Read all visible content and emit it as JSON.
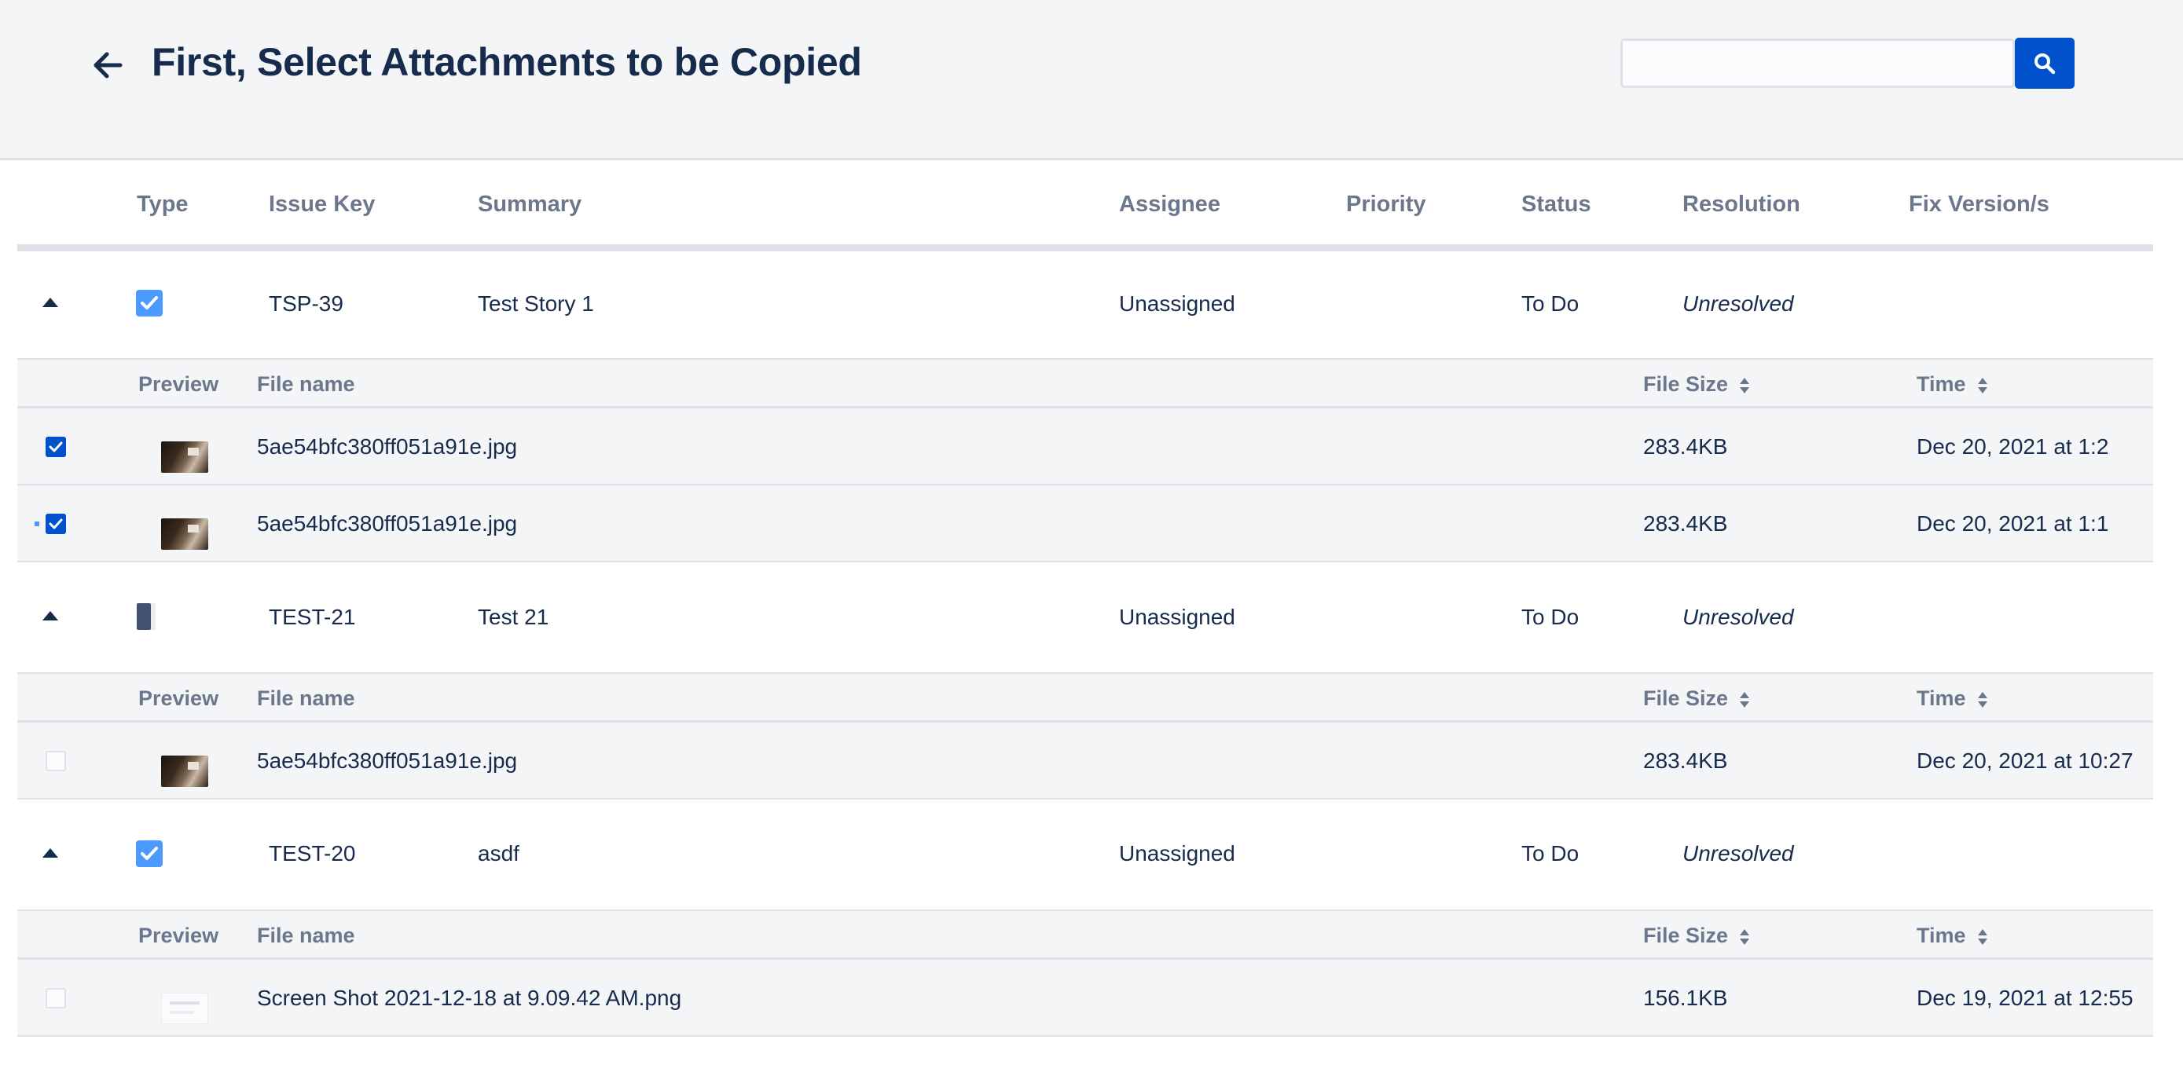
{
  "header": {
    "title": "First, Select Attachments to be Copied",
    "search_placeholder": "",
    "search_value": ""
  },
  "columns": {
    "type": "Type",
    "issue_key": "Issue Key",
    "summary": "Summary",
    "assignee": "Assignee",
    "priority": "Priority",
    "status": "Status",
    "resolution": "Resolution",
    "fix_versions": "Fix Version/s"
  },
  "attachment_columns": {
    "preview": "Preview",
    "file_name": "File name",
    "file_size": "File Size",
    "time": "Time"
  },
  "issues": [
    {
      "key": "TSP-39",
      "summary": "Test Story 1",
      "assignee": "Unassigned",
      "priority": "",
      "status": "To Do",
      "resolution": "Unresolved",
      "fix_versions": "",
      "selected": true,
      "type_icon": "story-icon",
      "attachments": [
        {
          "file_name": "5ae54bfc380ff051a91e.jpg",
          "file_size": "283.4KB",
          "time": "Dec 20, 2021 at 1:2",
          "selected": true,
          "preview": "photo"
        },
        {
          "file_name": "5ae54bfc380ff051a91e.jpg",
          "file_size": "283.4KB",
          "time": "Dec 20, 2021 at 1:1",
          "selected": true,
          "preview": "photo"
        }
      ]
    },
    {
      "key": "TEST-21",
      "summary": "Test 21",
      "assignee": "Unassigned",
      "priority": "",
      "status": "To Do",
      "resolution": "Unresolved",
      "fix_versions": "",
      "selected": false,
      "type_icon": "task-icon",
      "attachments": [
        {
          "file_name": "5ae54bfc380ff051a91e.jpg",
          "file_size": "283.4KB",
          "time": "Dec 20, 2021 at 10:27",
          "selected": false,
          "preview": "photo"
        }
      ]
    },
    {
      "key": "TEST-20",
      "summary": "asdf",
      "assignee": "Unassigned",
      "priority": "",
      "status": "To Do",
      "resolution": "Unresolved",
      "fix_versions": "",
      "selected": true,
      "type_icon": "story-icon",
      "attachments": [
        {
          "file_name": "Screen Shot 2021-12-18 at 9.09.42 AM.png",
          "file_size": "156.1KB",
          "time": "Dec 19, 2021 at 12:55",
          "selected": false,
          "preview": "document"
        }
      ]
    }
  ],
  "colors": {
    "accent": "#0052cc",
    "checkbox_light": "#4c9aff",
    "header_bg": "#f4f5f7",
    "text": "#172b4d",
    "muted": "#6b778c"
  }
}
